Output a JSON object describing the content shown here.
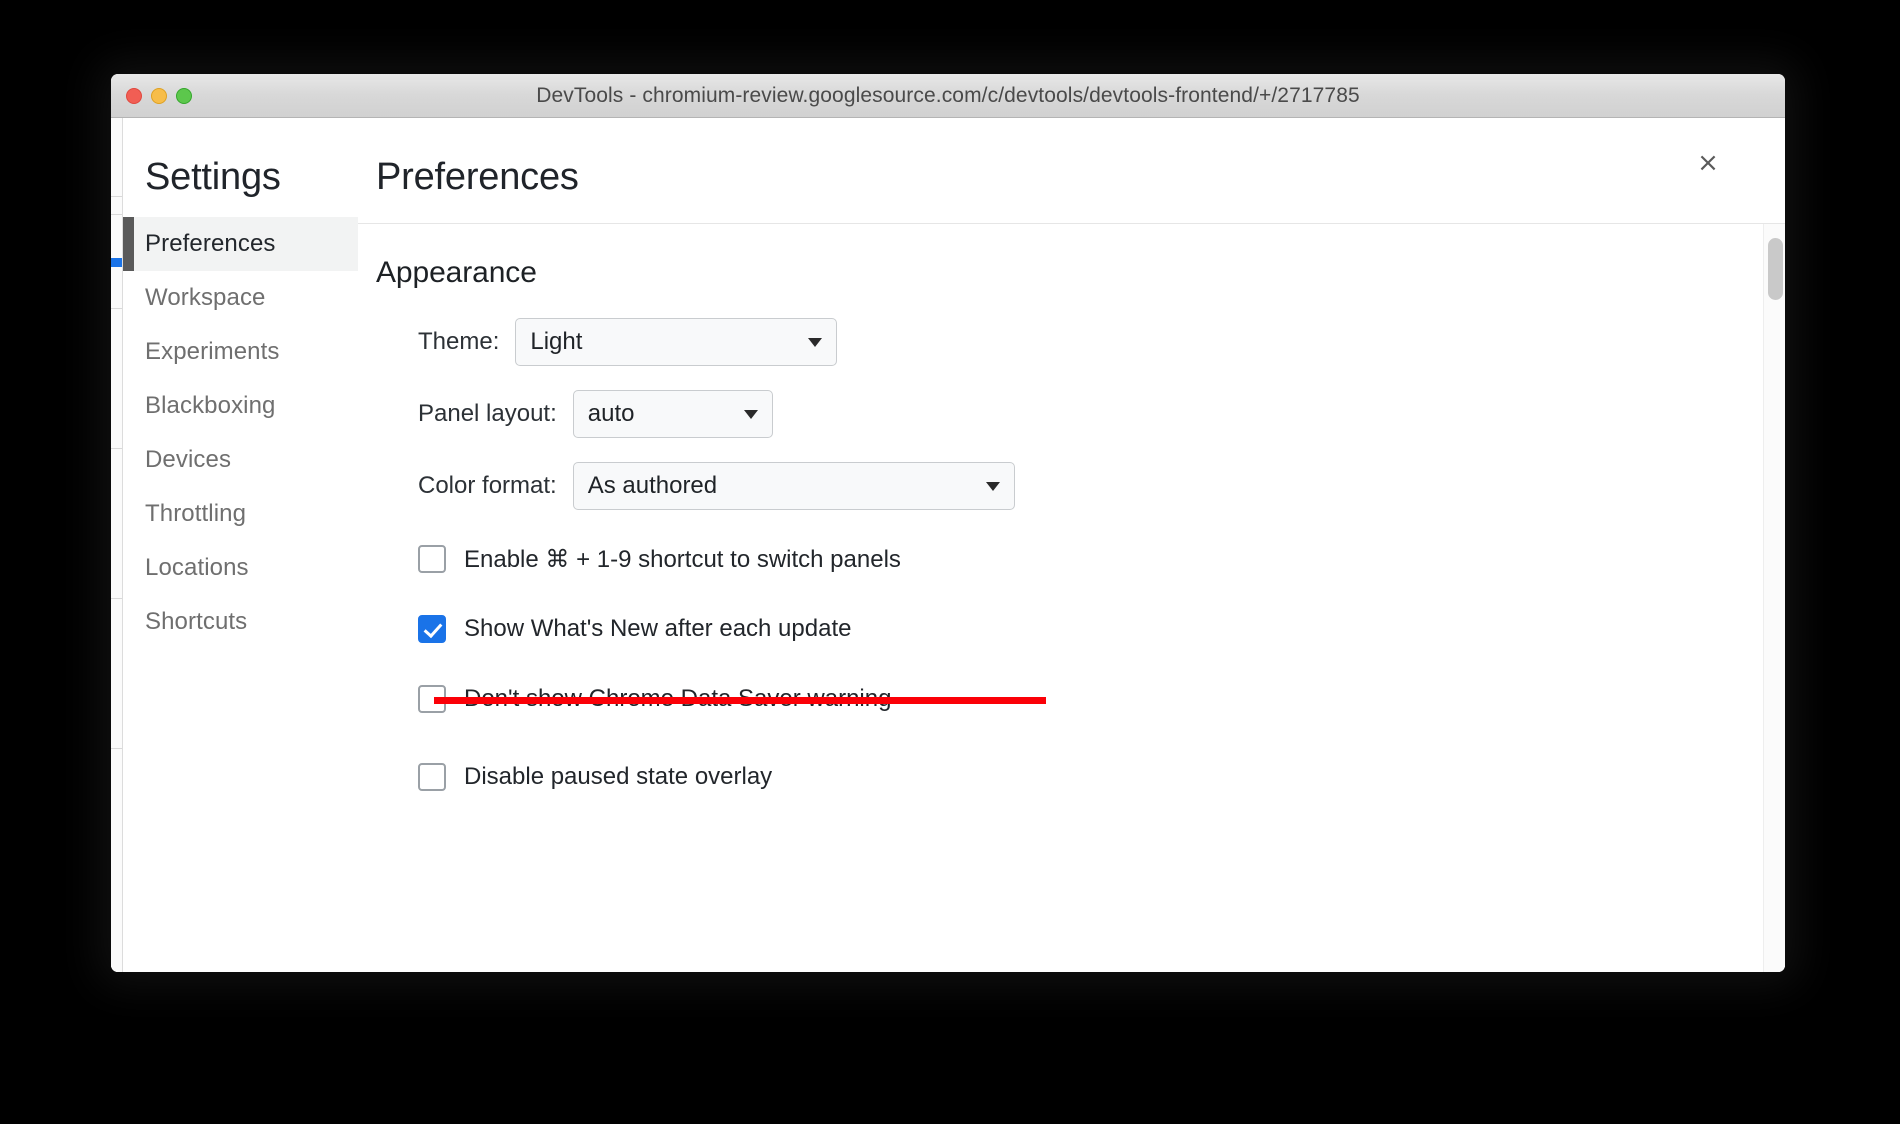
{
  "window": {
    "title": "DevTools - chromium-review.googlesource.com/c/devtools/devtools-frontend/+/2717785",
    "traffic_lights": {
      "close": "close-window",
      "minimize": "minimize-window",
      "zoom": "zoom-window"
    }
  },
  "dialog": {
    "close_label": "×",
    "sidebar": {
      "heading": "Settings",
      "items": [
        {
          "label": "Preferences",
          "selected": true
        },
        {
          "label": "Workspace",
          "selected": false
        },
        {
          "label": "Experiments",
          "selected": false
        },
        {
          "label": "Blackboxing",
          "selected": false
        },
        {
          "label": "Devices",
          "selected": false
        },
        {
          "label": "Throttling",
          "selected": false
        },
        {
          "label": "Locations",
          "selected": false
        },
        {
          "label": "Shortcuts",
          "selected": false
        }
      ]
    },
    "content": {
      "title": "Preferences",
      "section_title": "Appearance",
      "fields": [
        {
          "label": "Theme:",
          "value": "Light"
        },
        {
          "label": "Panel layout:",
          "value": "auto"
        },
        {
          "label": "Color format:",
          "value": "As authored"
        }
      ],
      "checkboxes": [
        {
          "label": "Enable ⌘ + 1-9 shortcut to switch panels",
          "checked": false,
          "struck": false
        },
        {
          "label": "Show What's New after each update",
          "checked": true,
          "struck": false
        },
        {
          "label": "Don't show Chrome Data Saver warning",
          "checked": false,
          "struck": true
        },
        {
          "label": "Disable paused state overlay",
          "checked": false,
          "struck": false
        }
      ]
    }
  },
  "annotation": {
    "strike_color": "#fb0007",
    "target": "Don't show Chrome Data Saver warning"
  },
  "colors": {
    "accent": "#1a73e8",
    "selected_bg": "#f2f3f3",
    "selected_bar": "#5a5a5a",
    "annotation_red": "#fb0007"
  }
}
